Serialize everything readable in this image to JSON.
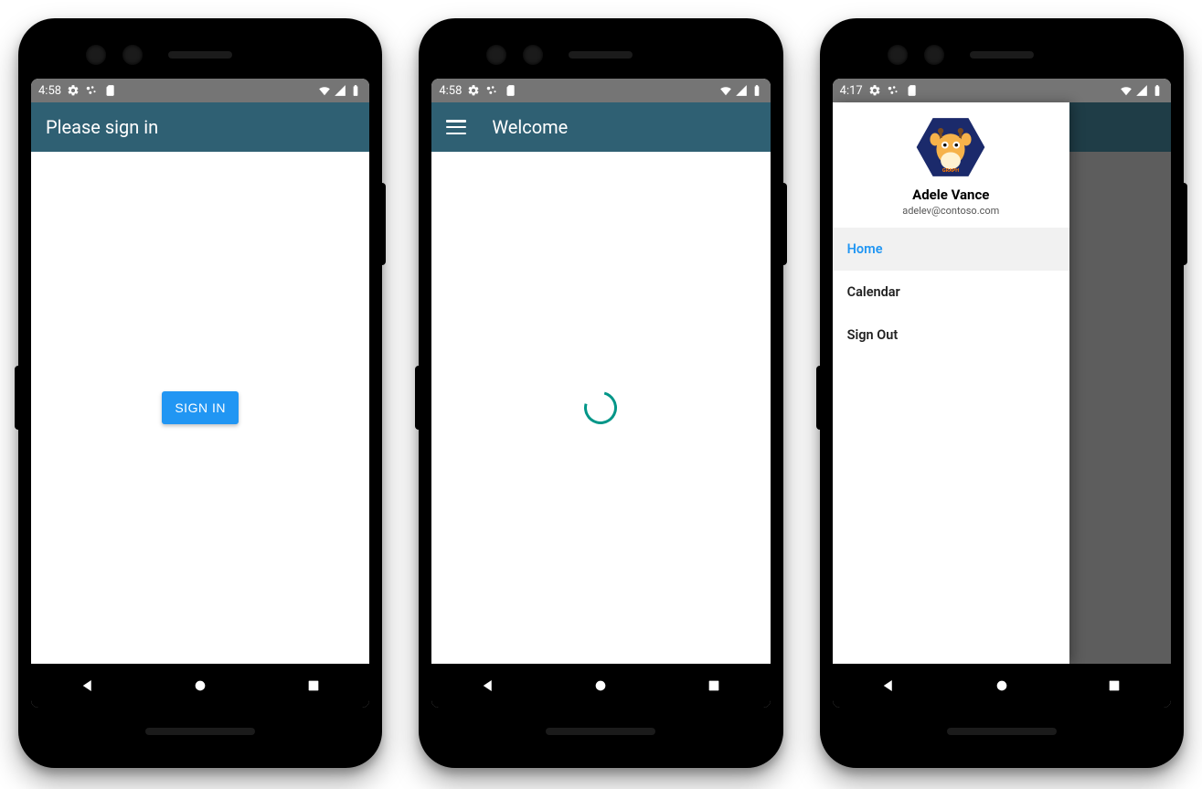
{
  "colors": {
    "appbar": "#2f6073",
    "accent": "#2196f3",
    "spinner": "#009688",
    "statusbar": "#757575"
  },
  "phone1": {
    "status": {
      "time": "4:58"
    },
    "appbar": {
      "title": "Please sign in"
    },
    "signin_button": "SIGN IN"
  },
  "phone2": {
    "status": {
      "time": "4:58"
    },
    "appbar": {
      "title": "Welcome"
    }
  },
  "phone3": {
    "status": {
      "time": "4:17"
    },
    "drawer": {
      "user_name": "Adele Vance",
      "user_email": "adelev@contoso.com",
      "avatar_label": "MICROSOFT GRAPH",
      "items": [
        {
          "label": "Home",
          "active": true
        },
        {
          "label": "Calendar",
          "active": false
        },
        {
          "label": "Sign Out",
          "active": false
        }
      ]
    }
  }
}
